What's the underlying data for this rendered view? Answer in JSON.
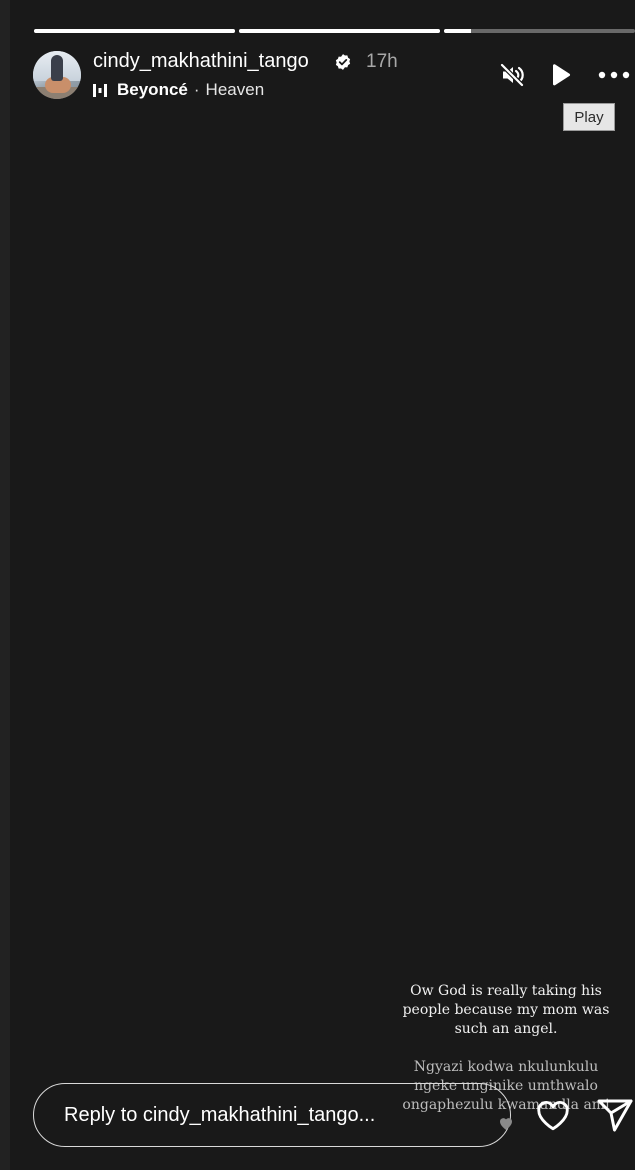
{
  "story": {
    "progress": [
      {
        "width": 201,
        "fill": 1.0
      },
      {
        "width": 201,
        "fill": 1.0
      },
      {
        "width": 191,
        "fill": 0.14
      }
    ],
    "username": "cindy_makhathini_tango",
    "time": "17h",
    "music": {
      "artist": "Beyoncé",
      "separator": "·",
      "song": "Heaven"
    },
    "icons": {
      "mute": "muted-speaker-icon",
      "play": "play-icon",
      "more": "more-options-icon",
      "verified": "verified-badge-icon",
      "music": "music-bars-icon"
    },
    "tooltip": "Play",
    "caption": {
      "line1": "Ow God is really taking his people because my mom was such an angel.",
      "line2": "Ngyazi kodwa nkulunkulu ngeke unginike umthwalo ongaphezulu kwamandla ami"
    }
  },
  "reply": {
    "placeholder": "Reply to cindy_makhathini_tango..."
  },
  "colors": {
    "background": "#191919",
    "text": "#ffffff",
    "muted_text": "#a8a8a8"
  }
}
